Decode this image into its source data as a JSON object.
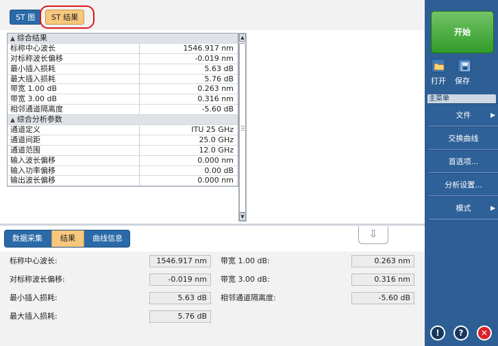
{
  "top_tabs": [
    "ST 图",
    "ST 结果"
  ],
  "summary_table": {
    "groups": [
      {
        "title": "综合结果",
        "rows": [
          {
            "label": "标称中心波长",
            "value": "1546.917 nm"
          },
          {
            "label": "对标称波长偏移",
            "value": "-0.019 nm"
          },
          {
            "label": "最小插入损耗",
            "value": "5.63 dB"
          },
          {
            "label": "最大插入损耗",
            "value": "5.76 dB"
          },
          {
            "label": "带宽 1.00 dB",
            "value": "0.263 nm"
          },
          {
            "label": "带宽 3.00 dB",
            "value": "0.316 nm"
          },
          {
            "label": "相邻通道隔离度",
            "value": "-5.60 dB"
          }
        ]
      },
      {
        "title": "综合分析参数",
        "rows": [
          {
            "label": "通道定义",
            "value": "ITU 25 GHz"
          },
          {
            "label": "通道间距",
            "value": "25.0 GHz"
          },
          {
            "label": "通道范围",
            "value": "12.0 GHz"
          },
          {
            "label": "输入波长偏移",
            "value": "0.000 nm"
          },
          {
            "label": "输入功率偏移",
            "value": "0.00 dB"
          },
          {
            "label": "输出波长偏移",
            "value": "0.000 nm"
          }
        ]
      }
    ]
  },
  "bottom_tabs": [
    "数据采集",
    "结果",
    "曲线信息"
  ],
  "selected_bottom_tab": "结果",
  "results_fields": {
    "left": [
      {
        "label": "标称中心波长:",
        "value": "1546.917 nm"
      },
      {
        "label": "对标称波长偏移:",
        "value": "-0.019 nm"
      },
      {
        "label": "最小插入损耗:",
        "value": "5.63 dB"
      },
      {
        "label": "最大插入损耗:",
        "value": "5.76 dB"
      }
    ],
    "right": [
      {
        "label": "带宽 1.00 dB:",
        "value": "0.263 nm"
      },
      {
        "label": "带宽 3.00 dB:",
        "value": "0.316 nm"
      },
      {
        "label": "相邻通道隔离度:",
        "value": "-5.60 dB"
      }
    ]
  },
  "sidebar": {
    "start_label": "开始",
    "open_label": "打开",
    "save_label": "保存",
    "menu_header": "主菜单",
    "menu_items": [
      {
        "label": "文件",
        "has_submenu": true
      },
      {
        "label": "交换曲线",
        "has_submenu": false
      },
      {
        "label": "首选项...",
        "has_submenu": false
      },
      {
        "label": "分析设置...",
        "has_submenu": false
      },
      {
        "label": "模式",
        "has_submenu": true
      }
    ],
    "footer_icons": [
      "info-icon",
      "help-icon",
      "close-icon"
    ]
  },
  "colors": {
    "tab_blue": "#2a6aa8",
    "tab_selected": "#f6c77c",
    "sidebar_blue": "#2e5f94",
    "start_green": "#3aa135",
    "highlight_ring": "#e0141e"
  }
}
